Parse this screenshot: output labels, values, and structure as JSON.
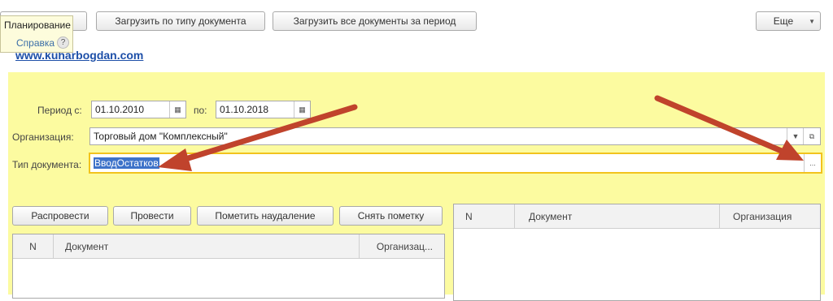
{
  "toolbar": {
    "load_by_type": "Загрузить по типу документа",
    "load_all_period": "Загрузить все документы за период",
    "more": "Еще"
  },
  "tooltip": {
    "title": "Планирование",
    "help_link": "Справка",
    "help_icon": "?"
  },
  "site_link": "www.kuharbogdan.com",
  "form": {
    "period_from_label": "Период с:",
    "period_from_value": "01.10.2010",
    "period_to_label": "по:",
    "period_to_value": "01.10.2018",
    "org_label": "Организация:",
    "org_value": "Торговый дом \"Комплексный\"",
    "doctype_label": "Тип документа:",
    "doctype_value": "ВводОстатков",
    "choose_icon": "..."
  },
  "left_buttons": {
    "unpost": "Распровести",
    "post": "Провести",
    "mark_delete": "Пометить наудаление",
    "unmark": "Снять пометку"
  },
  "left_table": {
    "columns": [
      "N",
      "Документ",
      "Организац..."
    ]
  },
  "right_table": {
    "columns": [
      "N",
      "Документ",
      "Организация"
    ]
  },
  "colors": {
    "panel": "#fcfba0",
    "arrow": "#c0432c",
    "highlight": "#f2c31d"
  },
  "icons": [
    "calendar-icon",
    "dropdown-arrow-icon",
    "open-icon",
    "choose-icon",
    "help-icon"
  ]
}
